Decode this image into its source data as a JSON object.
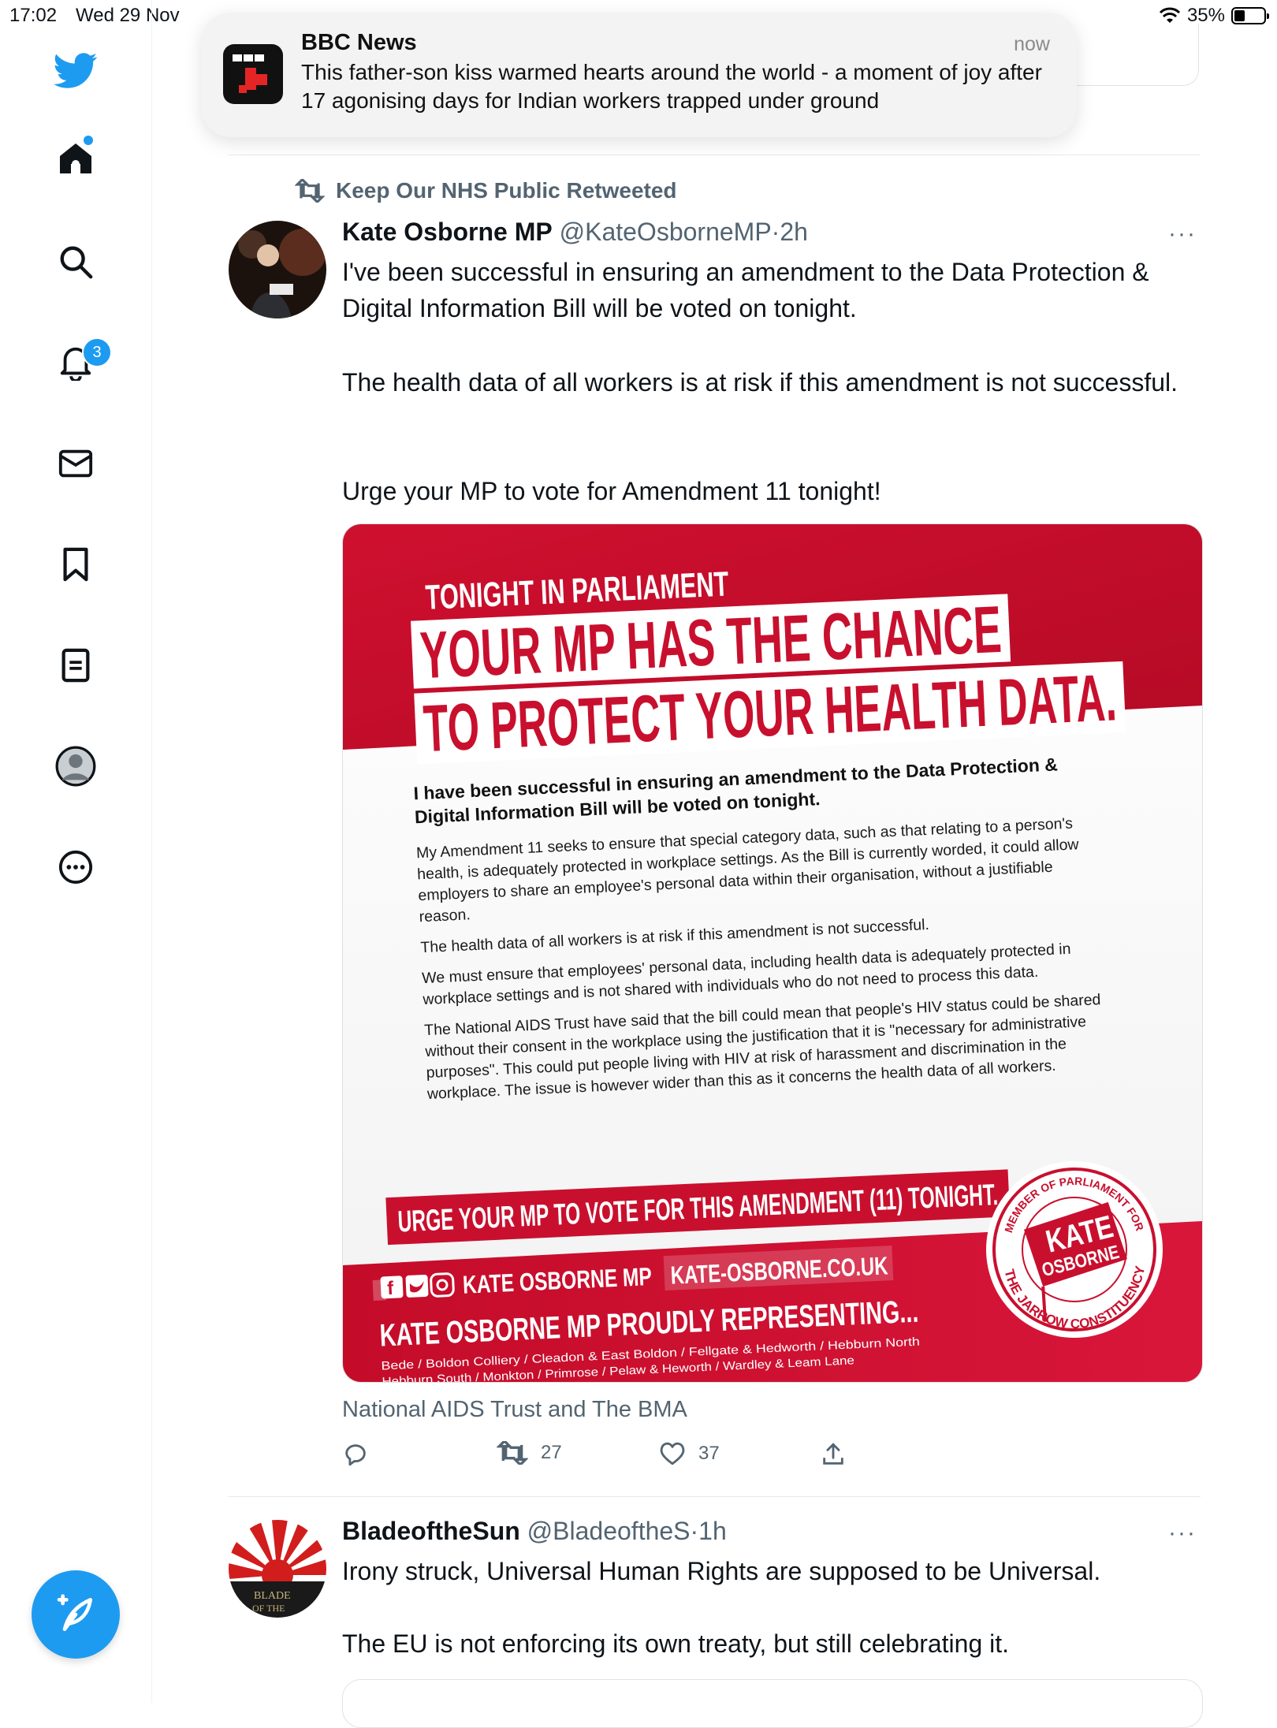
{
  "status_bar": {
    "time": "17:02",
    "date": "Wed 29 Nov",
    "battery": "35%",
    "battery_level": 0.35
  },
  "sidebar": {
    "notifications_count": "3",
    "items": [
      "home-icon",
      "search-icon",
      "notifications-icon",
      "messages-icon",
      "bookmarks-icon",
      "lists-icon",
      "profile-icon",
      "more-icon"
    ],
    "compose_icon": "feather-plus-icon"
  },
  "notification": {
    "app": "BBC News",
    "time": "now",
    "body": "This father-son kiss warmed hearts around the world - a moment of joy after 17 agonising days for Indian workers trapped under ground"
  },
  "tweet1": {
    "retweeted_by": "Keep Our NHS Public Retweeted",
    "name": "Kate Osborne MP",
    "handle": "@KateOsborneMP",
    "sep": "·",
    "time": "2h",
    "more": "···",
    "paragraphs": [
      "I've been successful in ensuring an amendment to the Data Protection & Digital Information Bill will be voted on tonight.",
      "The health data of all workers is at risk if this amendment is not successful.",
      "Urge your MP to vote for Amendment 11 tonight!"
    ],
    "poster": {
      "kicker": "TONIGHT IN PARLIAMENT",
      "headline1": "YOUR MP HAS THE CHANCE",
      "headline2": "TO PROTECT YOUR HEALTH DATA.",
      "lead": "I have been successful in ensuring an amendment to the Data Protection & Digital Information Bill will be voted on tonight.",
      "p1": "My Amendment 11 seeks to ensure that special category data, such as that relating to a person's health, is adequately protected in workplace settings. As the Bill is currently worded, it could allow employers to share an employee's personal data within their organisation, without a justifiable reason.",
      "p2": "The health data of all workers is at risk if this amendment is not successful.",
      "p3": "We must ensure that employees' personal data, including health data is adequately protected in workplace settings and is not shared with individuals who do not need to process this data.",
      "p4": "The National AIDS Trust have said that the bill could mean that people's HIV status could be shared without their consent in the workplace using the justification that it is \"necessary for administrative purposes\". This could put people living with HIV at risk of harassment and discrimination in the workplace. The issue is however wider than this as it concerns the health data of all workers.",
      "cta": "URGE YOUR MP TO VOTE FOR THIS AMENDMENT (11) TONIGHT.",
      "social": "KATE OSBORNE MP",
      "website": "KATE-OSBORNE.CO.UK",
      "representing": "KATE OSBORNE MP PROUDLY REPRESENTING...",
      "wards1": "Bede / Boldon Colliery / Cleadon & East Boldon / Fellgate & Hedworth / Hebburn North",
      "wards2": "Hebburn South / Monkton / Primrose / Pelaw & Heworth / Wardley & Leam Lane",
      "seal_top": "MEMBER OF PARLIAMENT FOR",
      "seal_name1": "KATE",
      "seal_name2": "OSBORNE",
      "seal_bottom": "THE JARROW CONSTITUENCY"
    },
    "caption": "National AIDS Trust and The BMA",
    "retweets": "27",
    "likes": "37"
  },
  "tweet2": {
    "name": "BladeoftheSun",
    "handle": "@BladeoftheS",
    "sep": "·",
    "time": "1h",
    "more": "···",
    "avatar_text1": "BLADE",
    "avatar_text2": "OF THE",
    "line1": "Irony struck, Universal Human Rights are supposed to be Universal.",
    "line2": "The EU is not enforcing its own treaty, but still celebrating it."
  },
  "colors": {
    "accent": "#1d9bf0",
    "poster_red": "#c8102e",
    "text_secondary": "#536471"
  }
}
